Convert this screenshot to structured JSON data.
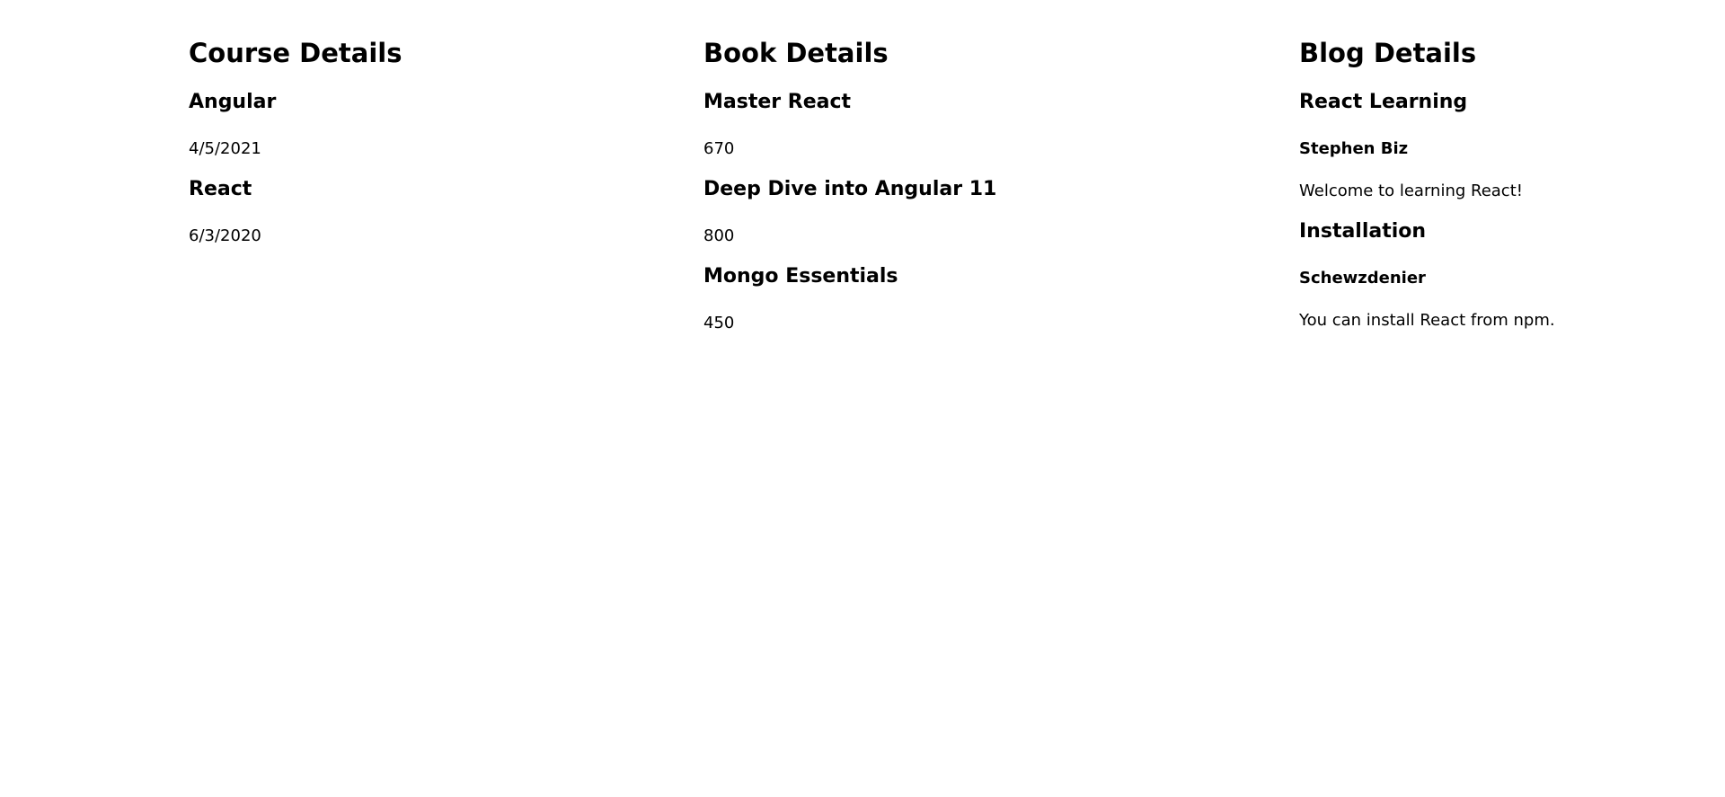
{
  "course": {
    "heading": "Course Details",
    "items": [
      {
        "name": "Angular",
        "date": "4/5/2021"
      },
      {
        "name": "React",
        "date": "6/3/2020"
      }
    ]
  },
  "book": {
    "heading": "Book Details",
    "items": [
      {
        "name": "Master React",
        "price": "670"
      },
      {
        "name": "Deep Dive into Angular 11",
        "price": "800"
      },
      {
        "name": "Mongo Essentials",
        "price": "450"
      }
    ]
  },
  "blog": {
    "heading": "Blog Details",
    "items": [
      {
        "title": "React Learning",
        "author": "Stephen Biz",
        "content": "Welcome to learning React!"
      },
      {
        "title": "Installation",
        "author": "Schewzdenier",
        "content": "You can install React from npm."
      }
    ]
  }
}
